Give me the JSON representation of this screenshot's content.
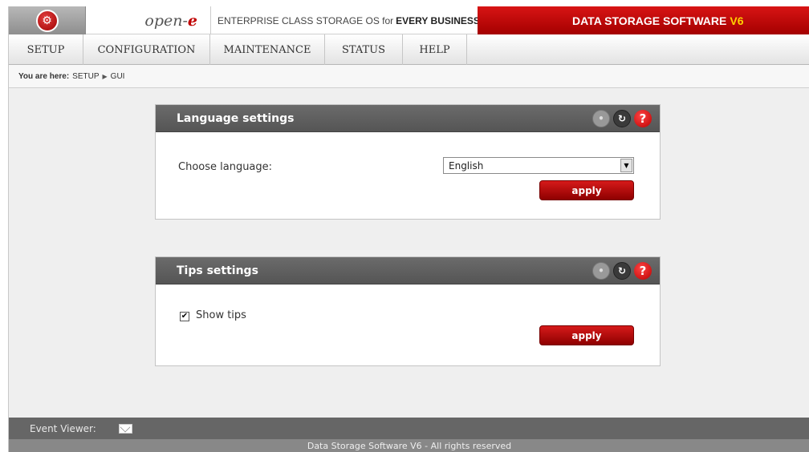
{
  "header": {
    "brand_prefix": "open-",
    "brand_suffix": "e",
    "tagline_start": "ENTERPRISE CLASS STORAGE OS for",
    "tagline_bold": "EVERY BUSINESS",
    "product": "DATA STORAGE SOFTWARE",
    "version": "V6"
  },
  "menu": [
    "SETUP",
    "CONFIGURATION",
    "MAINTENANCE",
    "STATUS",
    "HELP"
  ],
  "breadcrumb": {
    "prefix": "You are here:",
    "items": [
      "SETUP",
      "GUI"
    ]
  },
  "language_panel": {
    "title": "Language settings",
    "label": "Choose language:",
    "selected": "English",
    "apply_label": "apply"
  },
  "tips_panel": {
    "title": "Tips settings",
    "checkbox_label": "Show tips",
    "checked": true,
    "apply_label": "apply"
  },
  "footer": {
    "event_viewer": "Event Viewer:",
    "copyright": "Data Storage Software V6 - All rights reserved"
  },
  "colors": {
    "accent_red": "#c00000",
    "panel_header": "#5e5e5e"
  }
}
